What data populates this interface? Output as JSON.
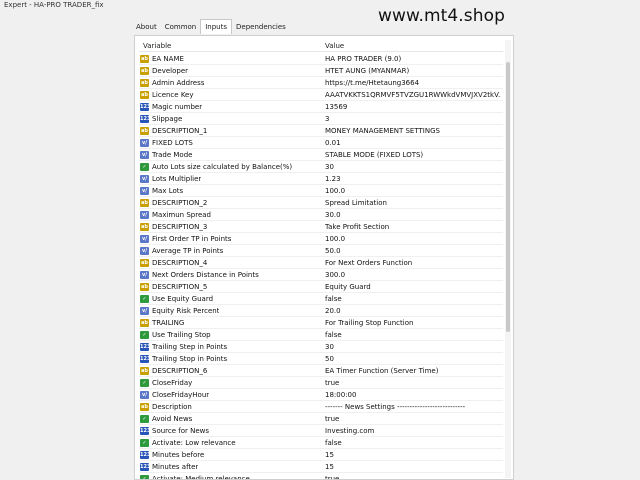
{
  "window_title": "Expert - HA-PRO TRADER_fix",
  "watermark": "www.mt4.shop",
  "tabs": [
    "About",
    "Common",
    "Inputs",
    "Dependencies"
  ],
  "columns": {
    "variable": "Variable",
    "value": "Value"
  },
  "rows": [
    {
      "icon": "ab",
      "name": "EA NAME",
      "value": "HA PRO TRADER (9.0)"
    },
    {
      "icon": "ab",
      "name": "Developer",
      "value": "HTET AUNG (MYANMAR)"
    },
    {
      "icon": "ab",
      "name": "Admin Address",
      "value": "https://t.me/Htetaung3664"
    },
    {
      "icon": "ab",
      "name": "Licence Key",
      "value": "AAATVKKTS1QRMVF5TVZGU1RWWkdVMVJXV2tkV..."
    },
    {
      "icon": "num",
      "name": "Magic number",
      "value": "13569"
    },
    {
      "icon": "num",
      "name": "Slippage",
      "value": "3"
    },
    {
      "icon": "ab",
      "name": "DESCRIPTION_1",
      "value": "MONEY MANAGEMENT SETTINGS"
    },
    {
      "icon": "enum",
      "name": "FIXED LOTS",
      "value": "0.01"
    },
    {
      "icon": "enum",
      "name": "Trade Mode",
      "value": "STABLE MODE (FIXED LOTS)"
    },
    {
      "icon": "bool",
      "name": "Auto Lots size calculated by Balance(%)",
      "value": "30"
    },
    {
      "icon": "enum",
      "name": "Lots Multiplier",
      "value": "1.23"
    },
    {
      "icon": "enum",
      "name": "Max Lots",
      "value": "100.0"
    },
    {
      "icon": "ab",
      "name": "DESCRIPTION_2",
      "value": "Spread Limitation"
    },
    {
      "icon": "enum",
      "name": "Maximun Spread",
      "value": "30.0"
    },
    {
      "icon": "ab",
      "name": "DESCRIPTION_3",
      "value": "Take Profit Section"
    },
    {
      "icon": "enum",
      "name": "First Order TP in Points",
      "value": "100.0"
    },
    {
      "icon": "enum",
      "name": "Average TP in Points",
      "value": "50.0"
    },
    {
      "icon": "ab",
      "name": "DESCRIPTION_4",
      "value": "For Next Orders Function"
    },
    {
      "icon": "enum",
      "name": "Next Orders Distance in Points",
      "value": "300.0"
    },
    {
      "icon": "ab",
      "name": "DESCRIPTION_5",
      "value": "Equity Guard"
    },
    {
      "icon": "bool",
      "name": "Use Equity Guard",
      "value": "false"
    },
    {
      "icon": "enum",
      "name": "Equity Risk Percent",
      "value": "20.0"
    },
    {
      "icon": "ab",
      "name": "TRAILING",
      "value": "For Trailing Stop Function"
    },
    {
      "icon": "bool",
      "name": "Use Trailing Stop",
      "value": "false"
    },
    {
      "icon": "num",
      "name": "Trailing Step in Points",
      "value": "30"
    },
    {
      "icon": "num",
      "name": "Trailing Stop in Points",
      "value": "50"
    },
    {
      "icon": "ab",
      "name": "DESCRIPTION_6",
      "value": "EA Timer Function (Server Time)"
    },
    {
      "icon": "bool",
      "name": "CloseFriday",
      "value": "true"
    },
    {
      "icon": "enum",
      "name": "CloseFridayHour",
      "value": "18:00:00"
    },
    {
      "icon": "ab",
      "name": "Description",
      "value": "------- News Settings ---------------------------"
    },
    {
      "icon": "bool",
      "name": "Avoid News",
      "value": "true"
    },
    {
      "icon": "num",
      "name": "Source for News",
      "value": "Investing.com"
    },
    {
      "icon": "bool",
      "name": "Activate: Low relevance",
      "value": "false"
    },
    {
      "icon": "num",
      "name": "Minutes before",
      "value": "15"
    },
    {
      "icon": "num",
      "name": "Minutes after",
      "value": "15"
    },
    {
      "icon": "bool",
      "name": "Activate: Medium relevance",
      "value": "true"
    }
  ],
  "icon_labels": {
    "ab": "ab",
    "num": "123",
    "bool": "✓",
    "enum": "v/"
  },
  "colors": {
    "ab": "#c8a000",
    "num": "#2a55b8",
    "bool": "#2e9a3c",
    "enum": "#5b77c8"
  }
}
